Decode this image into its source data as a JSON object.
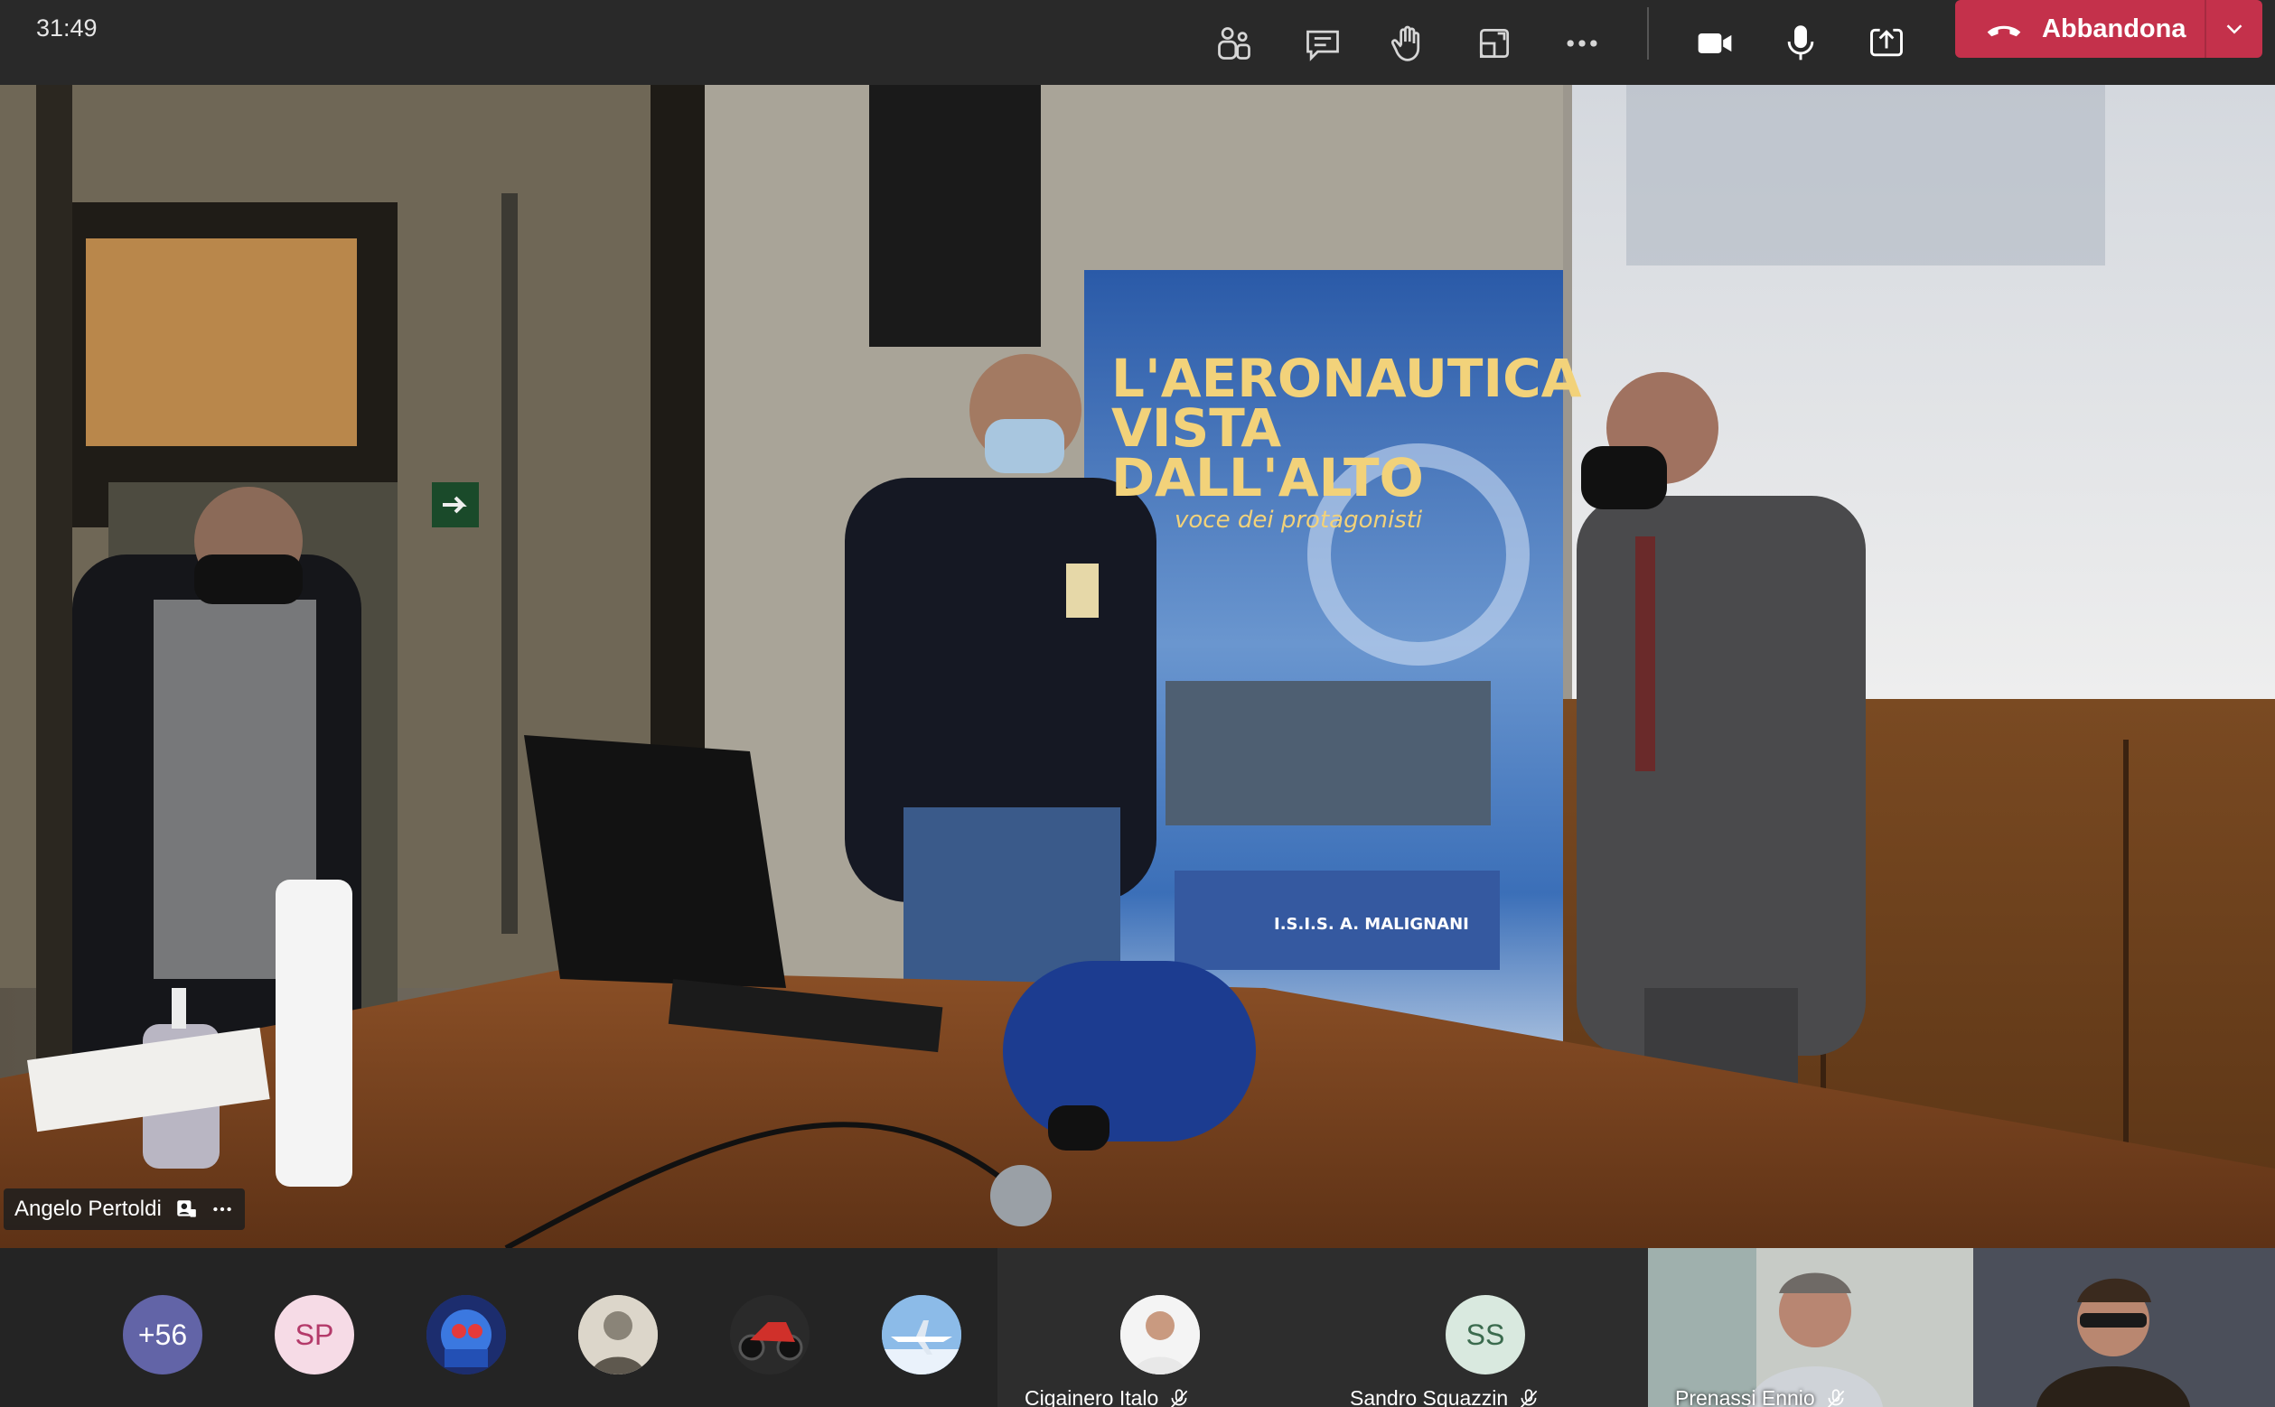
{
  "call": {
    "elapsed_time": "31:49"
  },
  "toolbar": {
    "icons": [
      "participants-icon",
      "chat-icon",
      "raise-hand-icon",
      "rooms-icon",
      "more-icon",
      "camera-icon",
      "microphone-icon",
      "share-icon"
    ],
    "leave_label": "Abbandona",
    "leave_color": "#c4314b"
  },
  "main_video": {
    "participant_name": "Angelo Pertoldi",
    "banner": {
      "line1": "L'AERONAUTICA",
      "line2": "VISTA",
      "line3": "DALL'ALTO",
      "subtitle": "voce dei protagonisti",
      "logo_text": "I.S.I.S. A. MALIGNANI"
    }
  },
  "participants_strip": {
    "overflow_count": "+56",
    "avatars": [
      {
        "initials": "SP",
        "bg": "#f6dbe6",
        "fg": "#b43a6a"
      },
      {
        "icon": "robot-avatar"
      },
      {
        "icon": "portrait-avatar"
      },
      {
        "icon": "motorbike-avatar"
      },
      {
        "icon": "airplane-avatar"
      }
    ],
    "tiles": [
      {
        "name": "Cigainero Italo",
        "type": "photo-avatar"
      },
      {
        "name": "Sandro Squazzin",
        "initials": "SS",
        "type": "initials"
      },
      {
        "name": "Prenassi Ennio",
        "type": "video"
      },
      {
        "name": "",
        "type": "video"
      }
    ]
  }
}
